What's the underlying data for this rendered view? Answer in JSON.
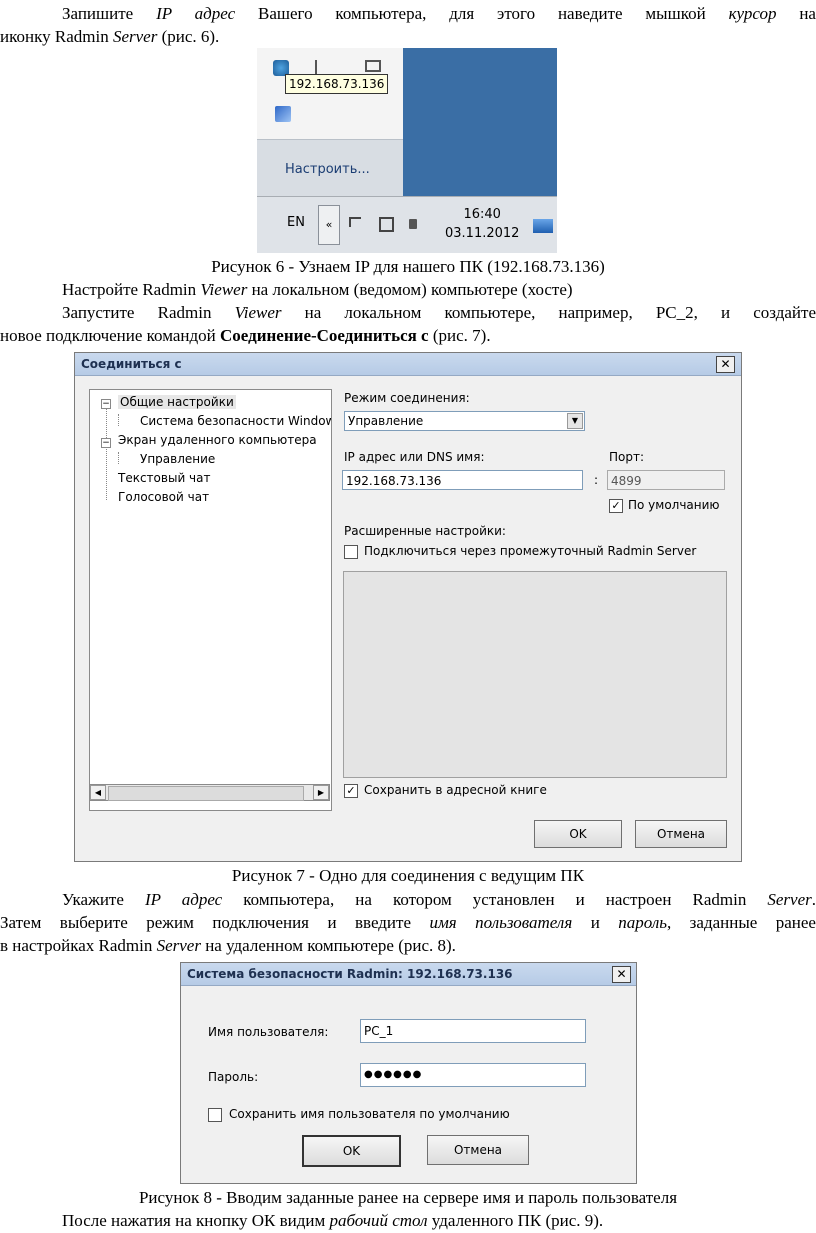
{
  "para1": {
    "t1": "Запишите ",
    "t2": "IP адрес",
    "t3": " Вашего компьютера, для этого наведите мышкой ",
    "t4": "курсор",
    "t5": " на",
    "line2a": "иконку Radmin ",
    "line2b": "Server",
    "line2c": " (рис. 6)."
  },
  "fig6": {
    "tooltip": "192.168.73.136",
    "customize": "Настроить...",
    "lang": "EN",
    "chevron": "«",
    "time": "16:40",
    "date": "03.11.2012",
    "icons": [
      "network-icon",
      "flag-icon",
      "volume-icon",
      "radmin-icon",
      "display-icon"
    ]
  },
  "caption6": "Рисунок 6 - Узнаем IP для нашего ПК (192.168.73.136)",
  "para2": {
    "a": "Настройте Radmin ",
    "b": "Viewer",
    "c": " на локальном (ведомом) компьютере (хосте)"
  },
  "para3": {
    "a": "Запустите Radmin ",
    "b": "Viewer",
    "c": " на локальном компьютере, например, PC_2, и создайте",
    "d": "новое подключение командой ",
    "e": "Соединение-Соединиться с",
    "f": " (рис. 7)."
  },
  "fig7": {
    "title": "Соединиться с",
    "close": "✕",
    "tree": [
      "Общие настройки",
      "Система безопасности Window",
      "Экран удаленного компьютера",
      "Управление",
      "Текстовый чат",
      "Голосовой чат"
    ],
    "mode_label": "Режим соединения:",
    "mode_value": "Управление",
    "ip_label": "IP адрес или DNS имя:",
    "ip_value": "192.168.73.136",
    "port_label": "Порт:",
    "port_value": "4899",
    "colon": ":",
    "default_label": "По умолчанию",
    "adv_label": "Расширенные настройки:",
    "intermediate_label": "Подключиться через промежуточный Radmin Server",
    "save_label": "Сохранить в адресной книге",
    "ok": "OK",
    "cancel": "Отмена"
  },
  "caption7": "Рисунок 7 - Одно для соединения с ведущим ПК",
  "para4": {
    "a": "Укажите ",
    "b": "IP адрес",
    "c": " компьютера, на котором установлен и настроен Radmin ",
    "d": "Server",
    "e": ".",
    "f": "Затем выберите режим подключения и введите ",
    "g": "имя пользователя",
    "h": " и ",
    "i": "пароль",
    "j": ", заданные ранее",
    "k": "в настройках Radmin ",
    "l": "Server",
    "m": " на удаленном компьютере (рис. 8)."
  },
  "fig8": {
    "title": "Система безопасности Radmin: 192.168.73.136",
    "close": "✕",
    "user_label": "Имя пользователя:",
    "user_value": "PC_1",
    "pass_label": "Пароль:",
    "pass_value": "●●●●●●",
    "remember_label": "Сохранить имя пользователя по умолчанию",
    "ok": "OK",
    "cancel": "Отмена"
  },
  "caption8": "Рисунок 8 - Вводим заданные ранее на сервере имя и пароль пользователя",
  "para5": {
    "a": "После нажатия на кнопку ОК видим ",
    "b": "рабочий стол",
    "c": " удаленного ПК (рис. 9)."
  }
}
